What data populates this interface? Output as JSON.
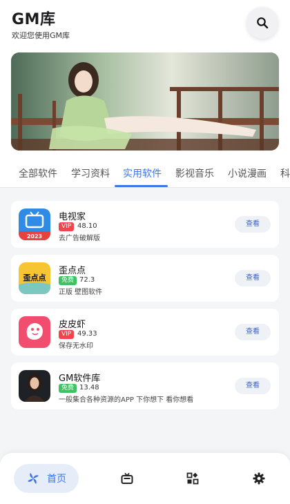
{
  "header": {
    "title": "GM库",
    "subtitle": "欢迎您使用GM库"
  },
  "tabs": [
    {
      "label": "全部软件",
      "active": false
    },
    {
      "label": "学习资料",
      "active": false
    },
    {
      "label": "实用软件",
      "active": true
    },
    {
      "label": "影视音乐",
      "active": false
    },
    {
      "label": "小说漫画",
      "active": false
    },
    {
      "label": "科",
      "active": false
    }
  ],
  "apps": [
    {
      "name": "电视家",
      "badge": "VIP",
      "badge_type": "vip",
      "rating": "48.10",
      "desc": "去广告破解版",
      "action": "查看",
      "icon": "tv-app-icon"
    },
    {
      "name": "歪点点",
      "badge": "免费",
      "badge_type": "free",
      "rating": "72.3",
      "desc": "正版 壁图软件",
      "action": "查看",
      "icon": "waidiandian-app-icon"
    },
    {
      "name": "皮皮虾",
      "badge": "VIP",
      "badge_type": "vip",
      "rating": "49.33",
      "desc": "保存无水印",
      "action": "查看",
      "icon": "pipixia-app-icon"
    },
    {
      "name": "GM软件库",
      "badge": "免费",
      "badge_type": "free",
      "rating": "13.48",
      "desc": "一般集合各种资源的APP 下你想下 看你想看",
      "action": "查看",
      "icon": "gm-library-app-icon"
    }
  ],
  "bottom_nav": {
    "home_label": "首页",
    "items": [
      "home-icon",
      "tv-icon",
      "apps-icon",
      "settings-icon"
    ]
  },
  "colors": {
    "accent": "#3b76e8",
    "vip": "#f1454d",
    "free": "#3fc262"
  }
}
